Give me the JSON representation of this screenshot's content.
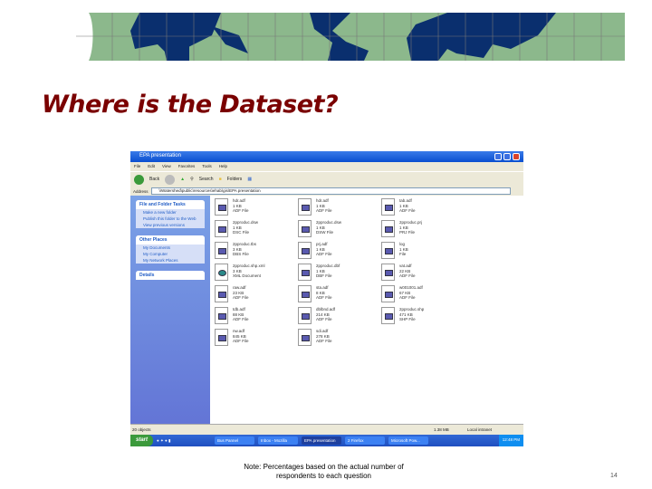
{
  "slide": {
    "title": "Where is the Dataset?",
    "note_line1": "Note: Percentages based on the actual number of",
    "note_line2": "respondents to each question",
    "page_number": "14",
    "colors": {
      "title": "#7a0000",
      "ocean": "#8cb88c",
      "land": "#0a2f6e"
    }
  },
  "window": {
    "title": "EPA presentation",
    "menu": [
      "File",
      "Edit",
      "View",
      "Favorites",
      "Tools",
      "Help"
    ],
    "toolbar": {
      "back": "Back",
      "search": "Search",
      "folders": "Folders"
    },
    "address_label": "Address",
    "address": "\\\\Watershed\\public\\resources\\ehab\\gis\\EPA presentation",
    "tasks_title": "File and Folder Tasks",
    "tasks": [
      "Make a new folder",
      "Publish this folder to the Web",
      "View previous versions"
    ],
    "places_title": "Other Places",
    "places": [
      "My Documents",
      "My Computer",
      "My Network Places"
    ],
    "details_title": "Details",
    "files": [
      {
        "name": "hdr.adf",
        "size": "1 KB",
        "type": "ADF File"
      },
      {
        "name": "2pproduc.dsw",
        "size": "1 KB",
        "type": "DSC File"
      },
      {
        "name": "2pproduc.tbs",
        "size": "3 KB",
        "type": "DBS File"
      },
      {
        "name": "2pproduc.shp.xml",
        "size": "3 KB",
        "type": "XML Document"
      },
      {
        "name": "raw.adf",
        "size": "23 KB",
        "type": "ADF File"
      },
      {
        "name": "tdb.adf",
        "size": "88 KB",
        "type": "ADF File"
      },
      {
        "name": "nw.adf",
        "size": "845 KB",
        "type": "ADF File"
      },
      {
        "name": "hdr.adf",
        "size": "1 KB",
        "type": "ADF File"
      },
      {
        "name": "2pproduc.dsw",
        "size": "1 KB",
        "type": "DSW File"
      },
      {
        "name": "prj.adf",
        "size": "1 KB",
        "type": "ADF File"
      },
      {
        "name": "2pproduc.dbf",
        "size": "1 KB",
        "type": "DBF File"
      },
      {
        "name": "sta.adf",
        "size": "8 KB",
        "type": "ADF File"
      },
      {
        "name": "dblbnd.adf",
        "size": "214 KB",
        "type": "ADF File"
      },
      {
        "name": "sdi.adf",
        "size": "278 KB",
        "type": "ADF File"
      },
      {
        "name": "tab.adf",
        "size": "1 KB",
        "type": "ADF File"
      },
      {
        "name": "2pproduc.prj",
        "size": "1 KB",
        "type": "PRJ File"
      },
      {
        "name": "log",
        "size": "1 KB",
        "type": "File"
      },
      {
        "name": "vat.adf",
        "size": "22 KB",
        "type": "ADF File"
      },
      {
        "name": "w001001.adf",
        "size": "67 KB",
        "type": "ADF File"
      },
      {
        "name": "2pproduc.shp",
        "size": "471 KB",
        "type": "SHP File"
      }
    ],
    "status_left": "20 objects",
    "status_size": "1.38 MB",
    "status_zone": "Local intranet",
    "taskbar": {
      "start": "start",
      "buttons": [
        "Bus Pannel",
        "Inbox - Mozilla",
        "EPA presentation",
        "2 Firefox",
        "Microsoft Pow..."
      ],
      "clock": "12:48 PM"
    }
  }
}
